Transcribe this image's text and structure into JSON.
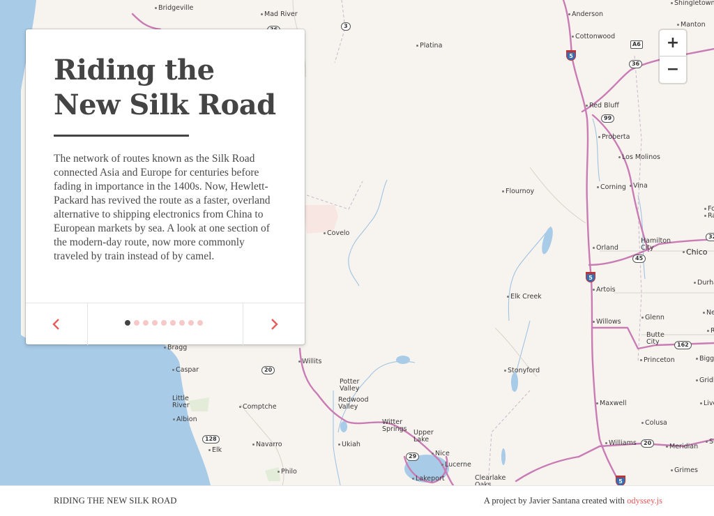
{
  "story": {
    "title_line1": "Riding the",
    "title_line2": "New Silk Road",
    "body": "The network of routes known as the Silk Road connected Asia and Europe for centuries before fading in importance in the 1400s. Now, Hewlett-Packard has revived the route as a faster, overland alternative to shipping electronics from China to European markets by sea. A look at one section of the modern-day route, now more commonly traveled by train instead of by camel.",
    "slide_count": 9,
    "active_slide": 1,
    "prev_icon": "chevron-left-icon",
    "next_icon": "chevron-right-icon"
  },
  "zoom": {
    "in_label": "+",
    "out_label": "−"
  },
  "footer": {
    "left": "RIDING THE NEW SILK ROAD",
    "credit_prefix": "A project by Javier Santana created with ",
    "credit_link": "odyssey.js"
  },
  "map": {
    "places": [
      {
        "label": "Bridgeville"
      },
      {
        "label": "Mad River"
      },
      {
        "label": "Platina"
      },
      {
        "label": "Anderson"
      },
      {
        "label": "Cottonwood"
      },
      {
        "label": "Shingletown"
      },
      {
        "label": "Manton"
      },
      {
        "label": "Red Bluff"
      },
      {
        "label": "Proberta"
      },
      {
        "label": "Los Molinos"
      },
      {
        "label": "Corning"
      },
      {
        "label": "Vina"
      },
      {
        "label": "Flournoy"
      },
      {
        "label": "Covelo"
      },
      {
        "label": "Orland"
      },
      {
        "label": "Hamilton City"
      },
      {
        "label": "Chico"
      },
      {
        "label": "Artois"
      },
      {
        "label": "Elk Creek"
      },
      {
        "label": "Willows"
      },
      {
        "label": "Glenn"
      },
      {
        "label": "Butte City"
      },
      {
        "label": "Princeton"
      },
      {
        "label": "Stonyford"
      },
      {
        "label": "Bragg"
      },
      {
        "label": "Caspar"
      },
      {
        "label": "Willits"
      },
      {
        "label": "Potter Valley"
      },
      {
        "label": "Redwood Valley"
      },
      {
        "label": "Little River"
      },
      {
        "label": "Comptche"
      },
      {
        "label": "Albion"
      },
      {
        "label": "Witter Springs"
      },
      {
        "label": "Upper Lake"
      },
      {
        "label": "Maxwell"
      },
      {
        "label": "Colusa"
      },
      {
        "label": "Williams"
      },
      {
        "label": "Meridian"
      },
      {
        "label": "Navarro"
      },
      {
        "label": "Elk"
      },
      {
        "label": "Ukiah"
      },
      {
        "label": "Nice"
      },
      {
        "label": "Lucerne"
      },
      {
        "label": "Philo"
      },
      {
        "label": "Lakeport"
      },
      {
        "label": "Clearlake Oaks"
      },
      {
        "label": "Grimes"
      },
      {
        "label": "Biggs"
      },
      {
        "label": "Gridle"
      },
      {
        "label": "Live"
      },
      {
        "label": "Durha"
      },
      {
        "label": "Nel"
      },
      {
        "label": "Ri"
      },
      {
        "label": "Su"
      },
      {
        "label": "For"
      },
      {
        "label": "Ran"
      }
    ],
    "shields": [
      {
        "label": "36"
      },
      {
        "label": "3"
      },
      {
        "label": "5"
      },
      {
        "label": "A6"
      },
      {
        "label": "36"
      },
      {
        "label": "99"
      },
      {
        "label": "45"
      },
      {
        "label": "5"
      },
      {
        "label": "162"
      },
      {
        "label": "20"
      },
      {
        "label": "128"
      },
      {
        "label": "29"
      },
      {
        "label": "20"
      },
      {
        "label": "5"
      },
      {
        "label": "32"
      }
    ]
  },
  "colors": {
    "water": "#a8cbe8",
    "land": "#f7f4ef",
    "highway": "#c97bb4",
    "accent": "#e85a5a",
    "text": "#444444"
  }
}
